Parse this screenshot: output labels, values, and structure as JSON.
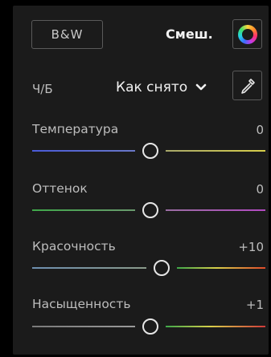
{
  "header": {
    "bw_button_label": "B&W",
    "mix_label": "Смеш."
  },
  "profile_row": {
    "label": "Ч/Б",
    "value": "Как снято"
  },
  "sliders": [
    {
      "label": "Температура",
      "value": "0",
      "position": 0.5
    },
    {
      "label": "Оттенок",
      "value": "0",
      "position": 0.5
    },
    {
      "label": "Красочность",
      "value": "+10",
      "position": 0.52
    },
    {
      "label": "Насыщенность",
      "value": "+1",
      "position": 0.5
    }
  ],
  "colors": {
    "panel_bg": "#1b1b1b",
    "temperature_left": "#4a5bd8",
    "temperature_right": "#d8cf4a",
    "tint_left": "#3fa84a",
    "tint_right": "#b34ac2",
    "vibrance_left": "#6e8fb0",
    "vibrance_right": "#e04a2a",
    "saturation_left": "#8a8a8a",
    "saturation_right": "#d03a3a"
  },
  "icons": {
    "color_wheel": "color-wheel-icon",
    "dropper": "eyedropper-icon",
    "chevron": "chevron-down-icon"
  }
}
